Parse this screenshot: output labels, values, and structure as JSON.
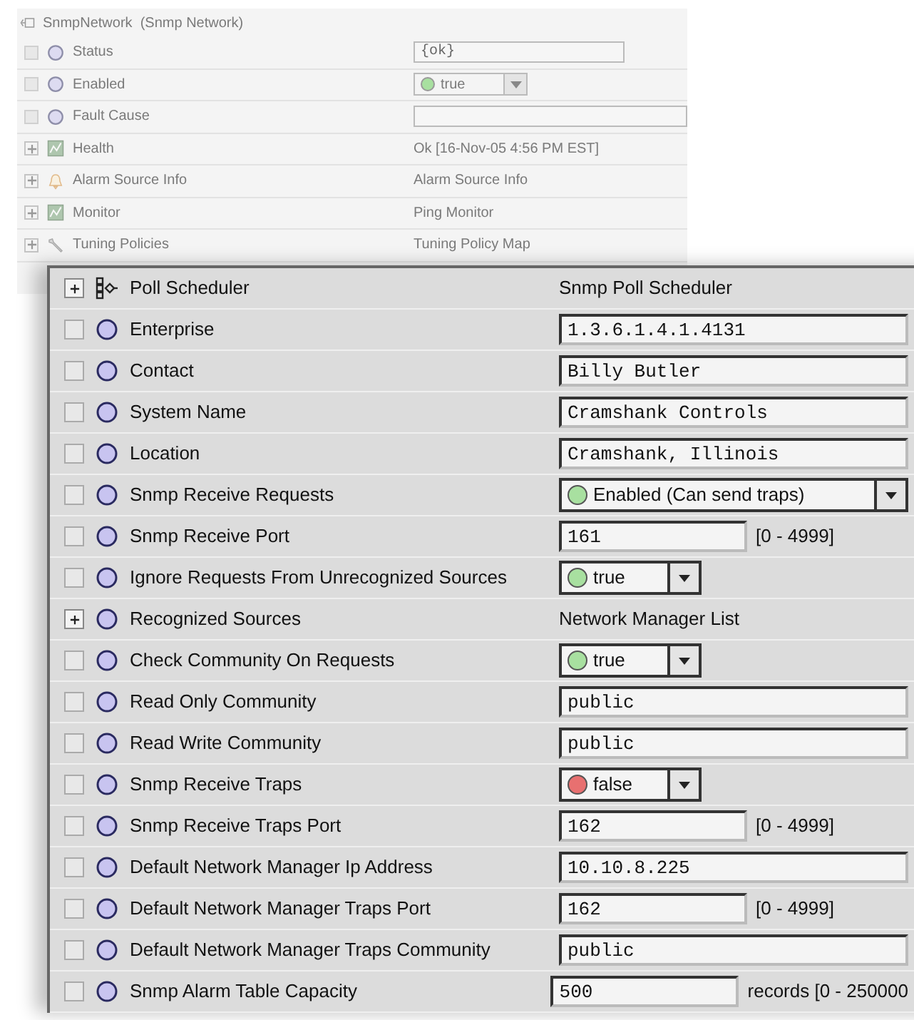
{
  "background_sheet": {
    "title": "SnmpNetwork  (Snmp Network)",
    "rows": [
      {
        "label": "Status",
        "kind": "slot",
        "expandable": false,
        "editor": {
          "kind": "field",
          "value": "{ok}"
        }
      },
      {
        "label": "Enabled",
        "kind": "slot",
        "expandable": false,
        "editor": {
          "kind": "select",
          "value": "true",
          "color": "#a8e0a0"
        }
      },
      {
        "label": "Fault Cause",
        "kind": "slot",
        "expandable": false,
        "editor": {
          "kind": "wide-field"
        }
      },
      {
        "label": "Health",
        "kind": "chart",
        "expandable": true,
        "editor": {
          "kind": "text",
          "value": "Ok [16-Nov-05 4:56 PM EST]"
        }
      },
      {
        "label": "Alarm Source Info",
        "kind": "bell",
        "expandable": true,
        "editor": {
          "kind": "text",
          "value": "Alarm Source Info"
        }
      },
      {
        "label": "Monitor",
        "kind": "chart",
        "expandable": true,
        "editor": {
          "kind": "text",
          "value": "Ping Monitor"
        }
      },
      {
        "label": "Tuning Policies",
        "kind": "wrench",
        "expandable": true,
        "editor": {
          "kind": "text",
          "value": "Tuning Policy Map"
        }
      }
    ]
  },
  "property_sheet": {
    "rows": [
      {
        "label": "Poll Scheduler",
        "kind": "scheduler",
        "expandable": true,
        "editor": {
          "kind": "text",
          "value": "Snmp Poll Scheduler"
        }
      },
      {
        "label": "Enterprise",
        "kind": "slot",
        "expandable": false,
        "editor": {
          "kind": "wide-field",
          "value": "1.3.6.1.4.1.4131"
        }
      },
      {
        "label": "Contact",
        "kind": "slot",
        "expandable": false,
        "editor": {
          "kind": "wide-field",
          "value": "Billy Butler"
        }
      },
      {
        "label": "System Name",
        "kind": "slot",
        "expandable": false,
        "editor": {
          "kind": "wide-field",
          "value": "Cramshank Controls"
        }
      },
      {
        "label": "Location",
        "kind": "slot",
        "expandable": false,
        "editor": {
          "kind": "wide-field",
          "value": "Cramshank, Illinois"
        }
      },
      {
        "label": "Snmp Receive Requests",
        "kind": "slot",
        "expandable": false,
        "editor": {
          "kind": "wide-select",
          "value": "Enabled (Can send traps)",
          "color": "#a8e0a0"
        }
      },
      {
        "label": "Snmp Receive Port",
        "kind": "slot",
        "expandable": false,
        "editor": {
          "kind": "range",
          "value": "161",
          "suffix": "[0 - 4999]"
        }
      },
      {
        "label": "Ignore Requests From Unrecognized Sources",
        "kind": "slot",
        "expandable": false,
        "editor": {
          "kind": "select",
          "value": "true",
          "color": "#a8e0a0"
        }
      },
      {
        "label": "Recognized Sources",
        "kind": "slot",
        "expandable": true,
        "editor": {
          "kind": "text",
          "value": "Network Manager List"
        }
      },
      {
        "label": "Check Community On Requests",
        "kind": "slot",
        "expandable": false,
        "editor": {
          "kind": "select",
          "value": "true",
          "color": "#a8e0a0"
        }
      },
      {
        "label": "Read Only Community",
        "kind": "slot",
        "expandable": false,
        "editor": {
          "kind": "wide-field",
          "value": "public"
        }
      },
      {
        "label": "Read Write Community",
        "kind": "slot",
        "expandable": false,
        "editor": {
          "kind": "wide-field",
          "value": "public"
        }
      },
      {
        "label": "Snmp Receive Traps",
        "kind": "slot",
        "expandable": false,
        "editor": {
          "kind": "select",
          "value": "false",
          "color": "#e87070"
        }
      },
      {
        "label": "Snmp Receive Traps Port",
        "kind": "slot",
        "expandable": false,
        "editor": {
          "kind": "range",
          "value": "162",
          "suffix": "[0 - 4999]"
        }
      },
      {
        "label": "Default Network Manager Ip Address",
        "kind": "slot",
        "expandable": false,
        "editor": {
          "kind": "wide-field",
          "value": "10.10.8.225"
        }
      },
      {
        "label": "Default Network Manager Traps Port",
        "kind": "slot",
        "expandable": false,
        "editor": {
          "kind": "range",
          "value": "162",
          "suffix": "[0 - 4999]"
        }
      },
      {
        "label": "Default Network Manager Traps Community",
        "kind": "slot",
        "expandable": false,
        "editor": {
          "kind": "wide-field",
          "value": "public"
        }
      },
      {
        "label": "Snmp Alarm Table Capacity",
        "kind": "slot",
        "expandable": false,
        "editor": {
          "kind": "range",
          "value": "500",
          "suffix": "records [0 - 250000"
        }
      }
    ]
  }
}
